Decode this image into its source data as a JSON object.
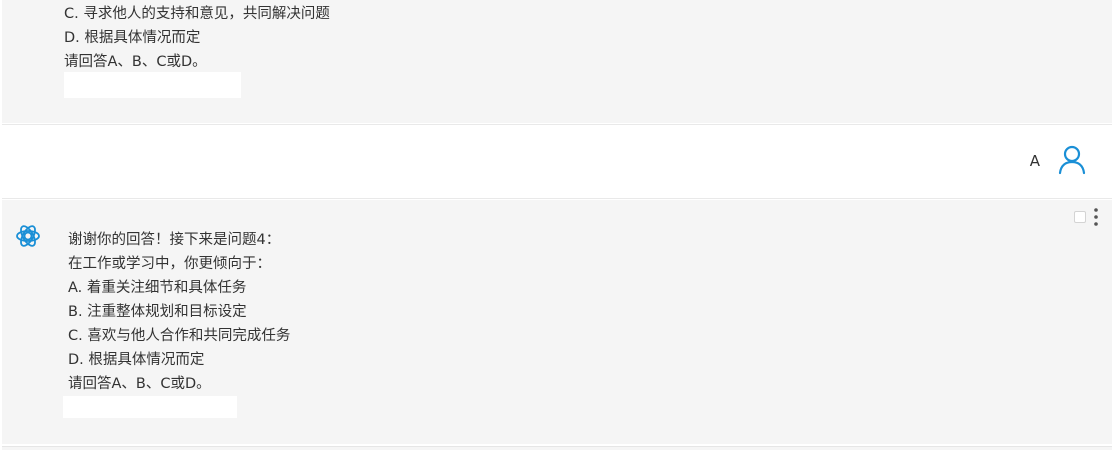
{
  "previous_message": {
    "lines": [
      "C. 寻求他人的支持和意见，共同解决问题",
      "D. 根据具体情况而定",
      "请回答A、B、C或D。"
    ]
  },
  "user_message": {
    "text": "A",
    "avatar_icon": "user-icon",
    "accent_color": "#1a8fd6"
  },
  "assistant_message": {
    "avatar_icon": "openai-logo-icon",
    "accent_color": "#1a8fd6",
    "lines": [
      "谢谢你的回答！接下来是问题4：",
      "在工作或学习中，你更倾向于：",
      "A. 着重关注细节和具体任务",
      "B. 注重整体规划和目标设定",
      "C. 喜欢与他人合作和共同完成任务",
      "D. 根据具体情况而定",
      "请回答A、B、C或D。"
    ],
    "actions": [
      "select-checkbox",
      "more-options-icon"
    ]
  }
}
